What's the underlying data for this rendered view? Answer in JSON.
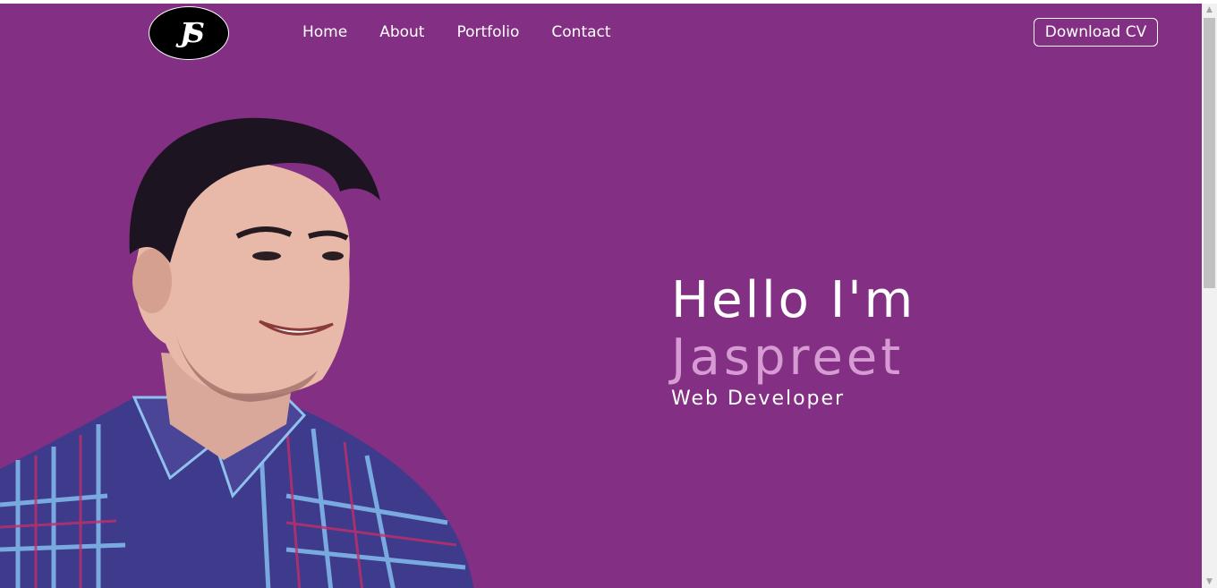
{
  "logo": {
    "text": "JS"
  },
  "nav": {
    "items": [
      {
        "label": "Home"
      },
      {
        "label": "About"
      },
      {
        "label": "Portfolio"
      },
      {
        "label": "Contact"
      }
    ]
  },
  "header": {
    "cv_button": "Download CV"
  },
  "hero": {
    "greeting": "Hello I'm",
    "name": "Jaspreet",
    "role": "Web Developer"
  },
  "colors": {
    "background": "#832f84",
    "name_accent": "#d69bd2",
    "text": "#ffffff"
  },
  "icons": {
    "scroll_up": "triangle-up",
    "scroll_down": "triangle-down"
  }
}
